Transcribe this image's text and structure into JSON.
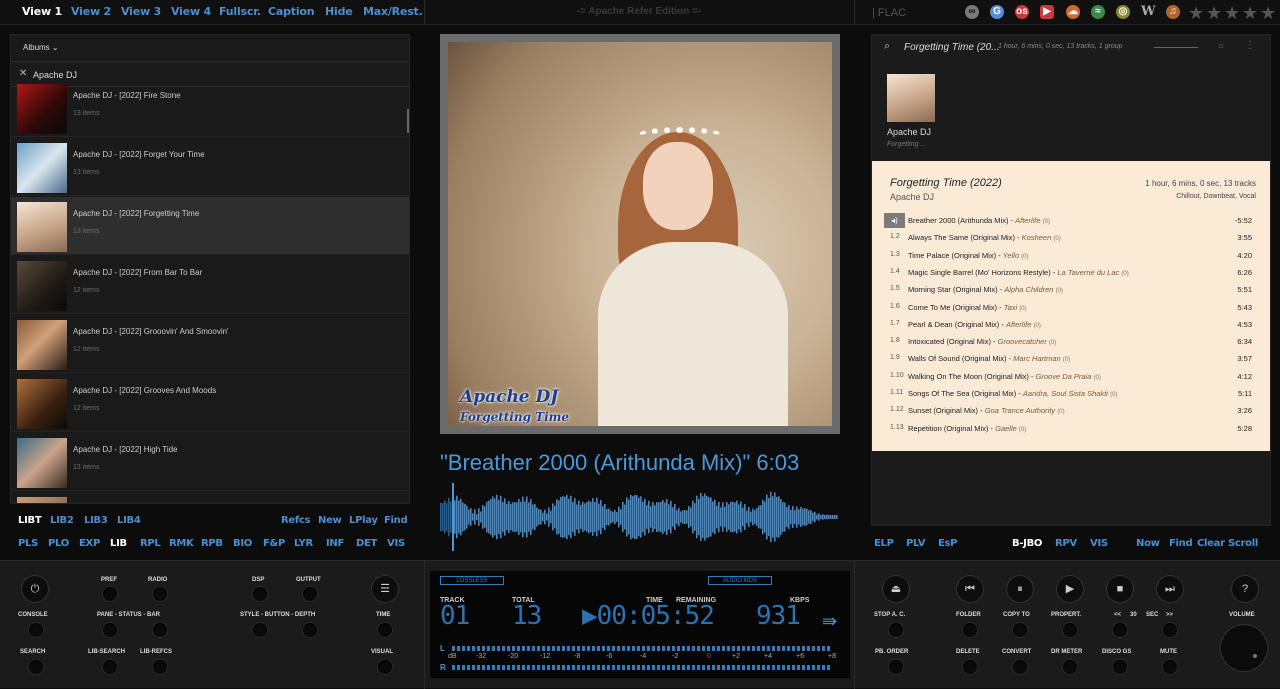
{
  "topbar": {
    "nav": [
      "View 1",
      "View 2",
      "View 3",
      "View 4",
      "Fullscr.",
      "Caption",
      "Hide",
      "Max/Rest."
    ],
    "edition": "-= Apache Refer Edition =-",
    "format": "| FLAC",
    "service_icons": [
      "lastfm-icon",
      "google-icon",
      "lastfm-red-icon",
      "youtube-icon",
      "soundcloud-icon",
      "spotify-icon",
      "discogs-icon",
      "wikipedia-icon",
      "musicbrainz-icon"
    ]
  },
  "library": {
    "dropdown": "Albums",
    "filter": "Apache DJ",
    "albums": [
      {
        "title": "Apache DJ - [2022] Fire Stone",
        "items": "13 items"
      },
      {
        "title": "Apache DJ - [2022] Forget Your Time",
        "items": "13 items"
      },
      {
        "title": "Apache DJ - [2022] Forgetting Time",
        "items": "13 items"
      },
      {
        "title": "Apache DJ - [2022] From Bar To Bar",
        "items": "12 items"
      },
      {
        "title": "Apache DJ - [2022] Grooovin' And Smoovin'",
        "items": "12 items"
      },
      {
        "title": "Apache DJ - [2022] Grooves And Moods",
        "items": "12 items"
      },
      {
        "title": "Apache DJ - [2022] High Tide",
        "items": "13 items"
      }
    ]
  },
  "art": {
    "line1": "Apache DJ",
    "line2": "Forgetting Time"
  },
  "now_playing": "\"Breather 2000 (Arithunda Mix)\" 6:03",
  "playlist": {
    "header_title": "Forgetting Time (20...",
    "header_meta": "1 hour, 6 mins, 0 sec,  13 tracks,  1 group",
    "thumb_artist": "Apache DJ",
    "thumb_album": "Forgetting ...",
    "album_title": "Forgetting Time (2022)",
    "album_artist": "Apache DJ",
    "album_meta1": "1 hour, 6 mins, 0 sec,   13 tracks",
    "album_meta2": "Chillout, Downbeat, Vocal",
    "tracks": [
      {
        "num": "",
        "title": "Breather 2000 (Arithunda Mix)",
        "artist": "Afterlife",
        "count": "(0)",
        "dur": "-5:52"
      },
      {
        "num": "1.2",
        "title": "Always The Same (Original Mix)",
        "artist": "Kosheen",
        "count": "(0)",
        "dur": "3:55"
      },
      {
        "num": "1.3",
        "title": "Time Palace (Original Mix)",
        "artist": "Yello",
        "count": "(0)",
        "dur": "4:20"
      },
      {
        "num": "1.4",
        "title": "Magic Single Barrel (Mo' Horizons Restyle)",
        "artist": "La Taverne du Lac",
        "count": "(0)",
        "dur": "6:26"
      },
      {
        "num": "1.5",
        "title": "Morning Star (Original Mix)",
        "artist": "Alpha Children",
        "count": "(0)",
        "dur": "5:51"
      },
      {
        "num": "1.6",
        "title": "Come To Me (Original Mix)",
        "artist": "Taxi",
        "count": "(0)",
        "dur": "5:43"
      },
      {
        "num": "1.7",
        "title": "Pearl & Dean (Original Mix)",
        "artist": "Afterlife",
        "count": "(0)",
        "dur": "4:53"
      },
      {
        "num": "1.8",
        "title": "Intoxicated (Original Mix)",
        "artist": "Groovecatcher",
        "count": "(0)",
        "dur": "6:34"
      },
      {
        "num": "1.9",
        "title": "Walls Of Sound (Original Mix)",
        "artist": "Marc Hartman",
        "count": "(0)",
        "dur": "3:57"
      },
      {
        "num": "1.10",
        "title": "Walking On The Moon (Original Mix)",
        "artist": "Groove Da Praia",
        "count": "(0)",
        "dur": "4:12"
      },
      {
        "num": "1.11",
        "title": "Songs Of The Sea (Original Mix)",
        "artist": "Aandra, Soul Sista Shakti",
        "count": "(0)",
        "dur": "5:11"
      },
      {
        "num": "1.12",
        "title": "Sunset (Original Mix)",
        "artist": "Goa Trance Authority",
        "count": "(0)",
        "dur": "3:26"
      },
      {
        "num": "1.13",
        "title": "Repetition (Original Mix)",
        "artist": "Gaelle",
        "count": "(0)",
        "dur": "5:28"
      }
    ]
  },
  "left_nav": {
    "row1_left": [
      "LIBT",
      "LIB2",
      "LIB3",
      "LIB4"
    ],
    "row1_right": [
      "Refcs",
      "New",
      "LPlay",
      "Find"
    ],
    "row2": [
      "PLS",
      "PLO",
      "EXP",
      "LIB",
      "RPL",
      "RMK",
      "RPB",
      "BIO",
      "F&P",
      "LYR",
      "INF",
      "DET",
      "VIS"
    ]
  },
  "right_nav": {
    "left": [
      "ELP",
      "PLV",
      "EsP"
    ],
    "middle": [
      "B-JBO",
      "RPV",
      "VIS"
    ],
    "right": [
      "Now",
      "Find",
      "Clear",
      "Scroll"
    ]
  },
  "controls_left": {
    "row1": [
      "PREF",
      "RADIO",
      "DSP",
      "OUTPUT"
    ],
    "row2": [
      "CONSOLE",
      "PANE - STATUS - BAR",
      "STYLE - BUTTON - DEPTH",
      "TIME"
    ],
    "row3": [
      "SEARCH",
      "LIB-SEARCH",
      "LIB-REFCS",
      "VISUAL"
    ]
  },
  "lcd": {
    "lossless": "LOSSLESS",
    "audio": "AUDIO MDS",
    "track_label": "TRACK",
    "total_label": "TOTAL",
    "time_label": "TIME",
    "remaining_label": "REMAINING",
    "kbps_label": "KBPS",
    "track": "01",
    "total": "13",
    "time": "▶00:05:52",
    "kbps": "931",
    "l": "L",
    "r": "R",
    "db": "dB",
    "scale": [
      "-32",
      "-20",
      "-12",
      "-8",
      "-6",
      "-4",
      "-2",
      "0",
      "+2",
      "+4",
      "+6",
      "+8"
    ]
  },
  "controls_right": {
    "row1": [
      "STOP A. C.",
      "FOLDER",
      "COPY TO",
      "PROPERT.",
      "<<",
      "30",
      "SEC",
      ">>",
      "VOLUME"
    ],
    "row2": [
      "PB. ORDER",
      "DELETE",
      "CONVERT",
      "DR METER",
      "DISCO GS",
      "MUTE"
    ]
  }
}
